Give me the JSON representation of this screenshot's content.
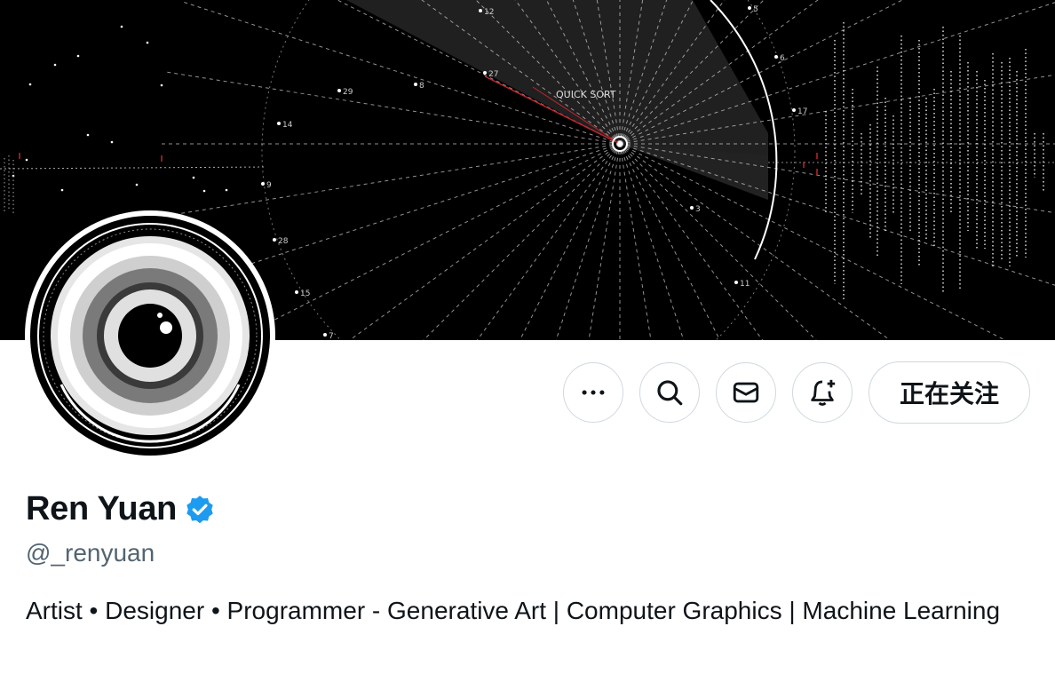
{
  "banner": {
    "label": "QUICK SORT",
    "numbers": [
      "12",
      "5",
      "6",
      "17",
      "27",
      "29",
      "8",
      "14",
      "9",
      "28",
      "15",
      "3",
      "11",
      "7"
    ]
  },
  "avatar": {
    "binary_text": "01100001 01101110 01010010 01100101"
  },
  "actions": {
    "more_icon": "more-horizontal",
    "search_icon": "magnifier",
    "message_icon": "envelope",
    "notify_icon": "bell-plus",
    "follow_label": "正在关注"
  },
  "profile": {
    "name": "Ren Yuan",
    "handle": "@_renyuan",
    "verified_color": "#1d9bf0",
    "bio": "Artist • Designer • Programmer - Generative Art | Computer Graphics | Machine Learning"
  }
}
